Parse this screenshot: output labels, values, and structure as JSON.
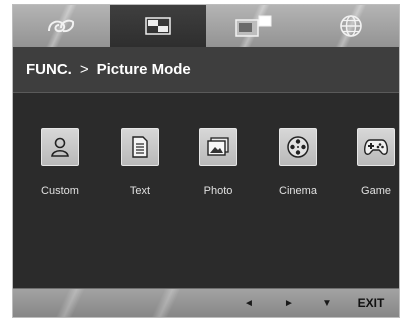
{
  "tabs": [
    {
      "icon": "eco-icon",
      "active": false
    },
    {
      "icon": "picture-icon",
      "active": true
    },
    {
      "icon": "multi-screen-icon",
      "active": false
    },
    {
      "icon": "globe-icon",
      "active": false
    }
  ],
  "header": {
    "func_label": "FUNC.",
    "separator": ">",
    "title": "Picture Mode"
  },
  "modes": [
    {
      "label": "Custom",
      "icon": "person-icon"
    },
    {
      "label": "Text",
      "icon": "document-icon"
    },
    {
      "label": "Photo",
      "icon": "photo-icon"
    },
    {
      "label": "Cinema",
      "icon": "film-reel-icon"
    },
    {
      "label": "Game",
      "icon": "gamepad-icon"
    }
  ],
  "footer": {
    "left_arrow": "◄",
    "right_arrow": "►",
    "down_arrow": "▼",
    "exit_label": "EXIT"
  },
  "colors": {
    "panel": "#2e2e2e",
    "title_bar": "#3e3e3e",
    "tab_bar": "#9c9c9c",
    "button_face": "#c8c8c8",
    "text": "#ffffff"
  }
}
